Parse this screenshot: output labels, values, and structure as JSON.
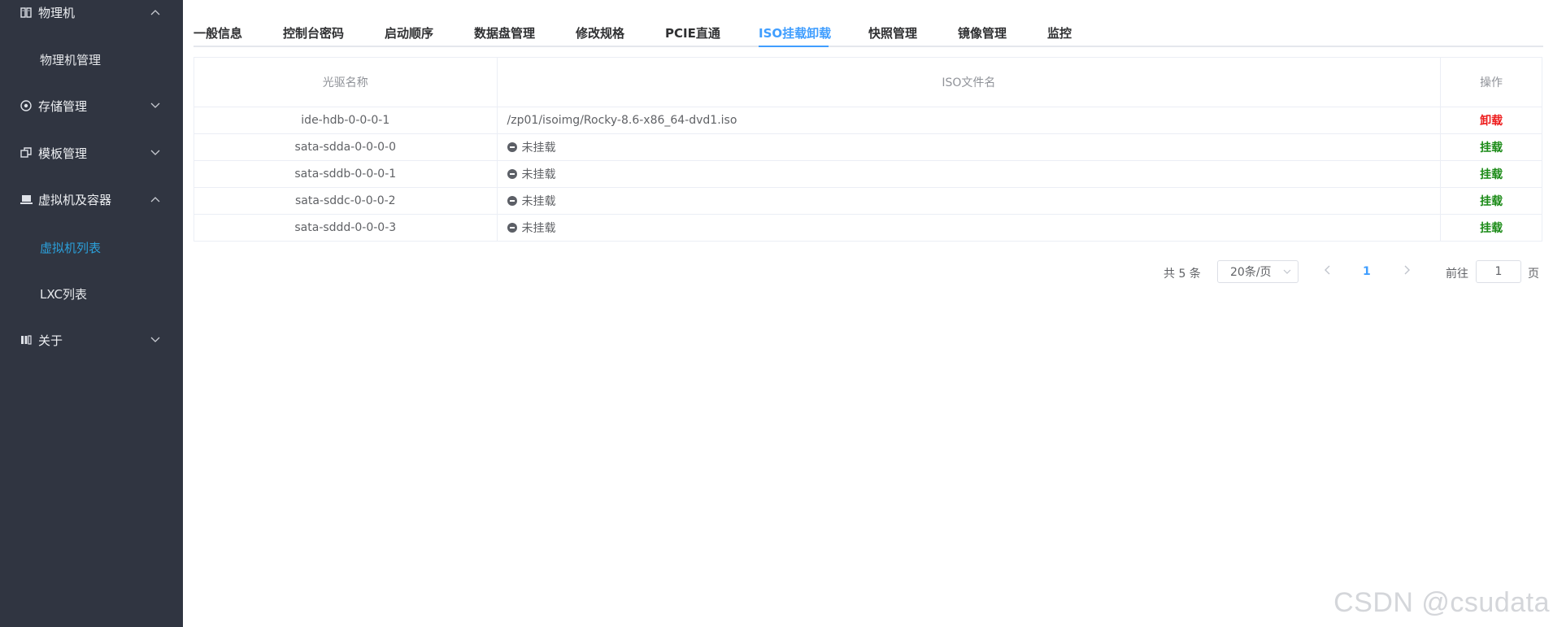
{
  "sidebar": {
    "groups": [
      {
        "label": "物理机",
        "icon": "server-icon",
        "expanded": true
      },
      {
        "label": "存储管理",
        "icon": "disk-icon",
        "expanded": false
      },
      {
        "label": "模板管理",
        "icon": "template-icon",
        "expanded": false
      },
      {
        "label": "虚拟机及容器",
        "icon": "vm-icon",
        "expanded": true
      },
      {
        "label": "关于",
        "icon": "about-icon",
        "expanded": false
      }
    ],
    "items": [
      {
        "label": "物理机管理",
        "active": false
      },
      {
        "label": "虚拟机列表",
        "active": true
      },
      {
        "label": "LXC列表",
        "active": false
      }
    ]
  },
  "tabs": [
    {
      "label": "一般信息",
      "active": false
    },
    {
      "label": "控制台密码",
      "active": false
    },
    {
      "label": "启动顺序",
      "active": false
    },
    {
      "label": "数据盘管理",
      "active": false
    },
    {
      "label": "修改规格",
      "active": false
    },
    {
      "label": "PCIE直通",
      "active": false
    },
    {
      "label": "ISO挂载卸载",
      "active": true
    },
    {
      "label": "快照管理",
      "active": false
    },
    {
      "label": "镜像管理",
      "active": false
    },
    {
      "label": "监控",
      "active": false
    }
  ],
  "table": {
    "headers": [
      "光驱名称",
      "ISO文件名",
      "操作"
    ],
    "rows": [
      {
        "drive": "ide-hdb-0-0-0-1",
        "iso": "/zp01/isoimg/Rocky-8.6-x86_64-dvd1.iso",
        "mounted": true,
        "action": "卸载"
      },
      {
        "drive": "sata-sdda-0-0-0-0",
        "iso": "未挂载",
        "mounted": false,
        "action": "挂载"
      },
      {
        "drive": "sata-sddb-0-0-0-1",
        "iso": "未挂载",
        "mounted": false,
        "action": "挂载"
      },
      {
        "drive": "sata-sddc-0-0-0-2",
        "iso": "未挂载",
        "mounted": false,
        "action": "挂载"
      },
      {
        "drive": "sata-sddd-0-0-0-3",
        "iso": "未挂载",
        "mounted": false,
        "action": "挂载"
      }
    ]
  },
  "pagination": {
    "total": "共 5 条",
    "page_size": "20条/页",
    "current_page": "1",
    "goto_label": "前往",
    "goto_value": "1",
    "page_suffix": "页"
  },
  "watermark": "CSDN @csudata",
  "colors": {
    "sidebar_bg": "#303541",
    "accent": "#409eff",
    "active_menu": "#2b9fd9",
    "unmount": "#ee1b1b",
    "mount": "#1a8a16"
  }
}
